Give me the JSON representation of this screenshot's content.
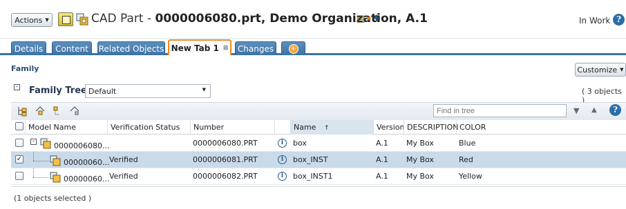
{
  "header": {
    "actions_label": "Actions",
    "title_prefix": "CAD Part - ",
    "title_main": "0000006080.prt, Demo Organization, A.1",
    "state": "In Work",
    "help": "?"
  },
  "tabs": [
    {
      "label": "Details"
    },
    {
      "label": "Content"
    },
    {
      "label": "Related Objects"
    },
    {
      "label": "New Tab 1",
      "close": "⊠"
    },
    {
      "label": "Changes"
    }
  ],
  "family": {
    "section_label": "Family",
    "customize_label": "Customize"
  },
  "family_tree": {
    "title": "Family Tree",
    "view_value": "Default",
    "object_count": "( 3 objects )",
    "find_placeholder": "Find in tree"
  },
  "table": {
    "columns": [
      "Model Name",
      "Verification Status",
      "Number",
      "Name",
      "Version",
      "DESCRIPTION",
      "COLOR"
    ],
    "rows": [
      {
        "model_name": "0000006080....",
        "verification": "",
        "number": "0000006080.PRT",
        "name": "box",
        "version": "A.1",
        "description": "My Box",
        "color": "Blue",
        "checked": false
      },
      {
        "model_name": "00000060...",
        "verification": "Verified",
        "number": "0000006081.PRT",
        "name": "box_INST",
        "version": "A.1",
        "description": "My Box",
        "color": "Red",
        "checked": true
      },
      {
        "model_name": "00000060...",
        "verification": "Verified",
        "number": "0000006082.PRT",
        "name": "box_INST1",
        "version": "A.1",
        "description": "My Box",
        "color": "Yellow",
        "checked": false
      }
    ]
  },
  "status": {
    "selected_text": "(1 objects selected )"
  }
}
